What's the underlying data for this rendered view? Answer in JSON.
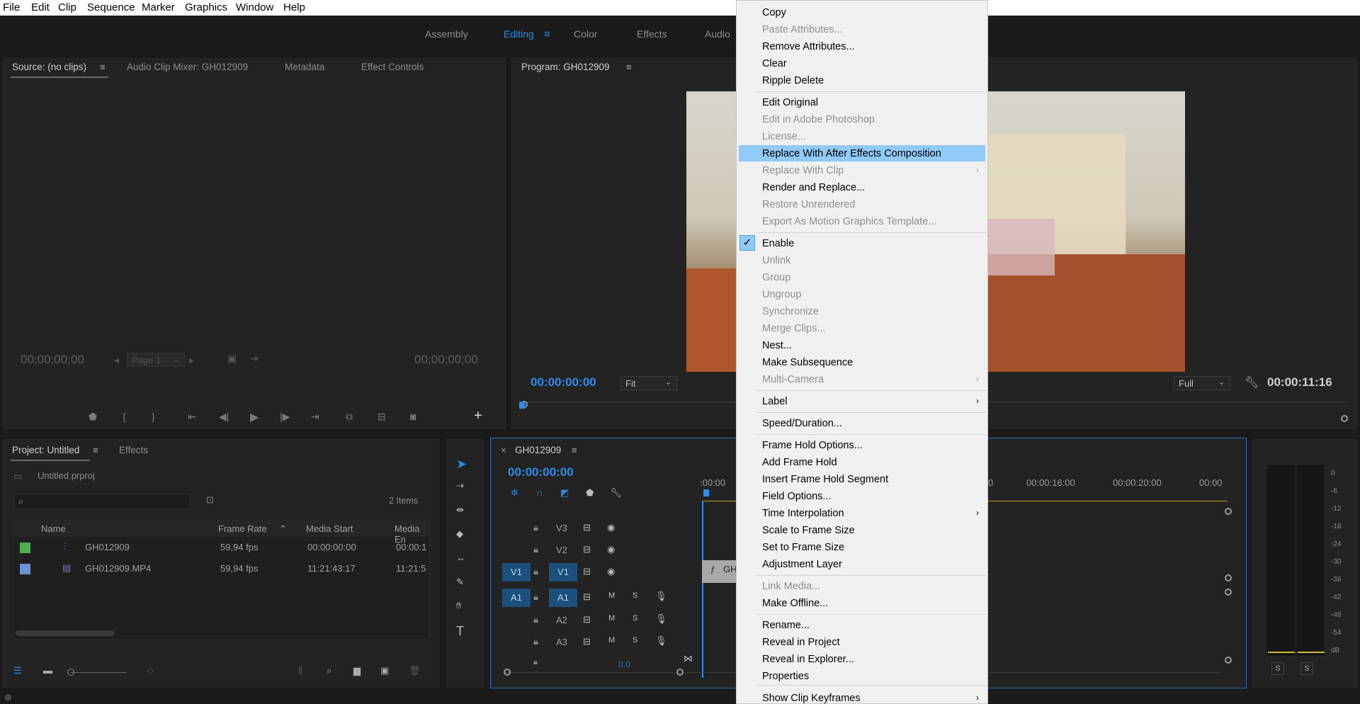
{
  "menubar": {
    "items": [
      "File",
      "Edit",
      "Clip",
      "Sequence",
      "Marker",
      "Graphics",
      "Window",
      "Help"
    ]
  },
  "workspaces": {
    "items": [
      "Assembly",
      "Editing",
      "Color",
      "Effects",
      "Audio"
    ],
    "active": "Editing"
  },
  "source_panel": {
    "tabs": [
      "Source: (no clips)",
      "Audio Clip Mixer: GH012909",
      "Metadata",
      "Effect Controls"
    ],
    "timecode_left": "00;00;00;00",
    "timecode_right": "00;00;00;00",
    "page_select": "Page 1"
  },
  "program_panel": {
    "title": "Program: GH012909",
    "timecode_current": "00:00:00:00",
    "fit_select": "Fit",
    "quality_select": "Full",
    "timecode_duration": "00:00:11:16"
  },
  "project_panel": {
    "tabs": [
      "Project: Untitled",
      "Effects"
    ],
    "file_name": "Untitled.prproj",
    "item_count": "2 Items",
    "columns": [
      "Name",
      "Frame Rate",
      "Media Start",
      "Media En"
    ],
    "rows": [
      {
        "color": "#4caf50",
        "name": "GH012909",
        "frame_rate": "59,94 fps",
        "media_start": "00:00:00:00",
        "media_end": "00:00:1"
      },
      {
        "color": "#6a93d4",
        "name": "GH012909.MP4",
        "frame_rate": "59,94 fps",
        "media_start": "11:21:43:17",
        "media_end": "11:21:5"
      }
    ]
  },
  "timeline": {
    "sequence_name": "GH012909",
    "timecode": "00:00:00:00",
    "ruler": [
      ":00:00",
      "0",
      "00:00:16:00",
      "00:00:20:00",
      "00:00"
    ],
    "video_tracks": [
      "V3",
      "V2",
      "V1"
    ],
    "audio_tracks": [
      "A1",
      "A2",
      "A3"
    ],
    "source_v": "V1",
    "source_a": "A1",
    "clip_label": "GH",
    "mute_label": "M",
    "solo_label": "S",
    "bottom_value": "0.0"
  },
  "meter": {
    "labels": [
      "0",
      "-6",
      "-12",
      "-18",
      "-24",
      "-30",
      "-36",
      "-42",
      "-48",
      "-54",
      "dB"
    ],
    "solo_buttons": [
      "S",
      "S"
    ]
  },
  "context_menu": {
    "items": [
      {
        "label": "Copy",
        "enabled": true
      },
      {
        "label": "Paste Attributes...",
        "enabled": false
      },
      {
        "label": "Remove Attributes...",
        "enabled": true
      },
      {
        "label": "Clear",
        "enabled": true
      },
      {
        "label": "Ripple Delete",
        "enabled": true
      },
      {
        "label": "Edit Original",
        "enabled": true
      },
      {
        "label": "Edit in Adobe Photoshop",
        "enabled": false
      },
      {
        "label": "License...",
        "enabled": false
      },
      {
        "label": "Replace With After Effects Composition",
        "enabled": true,
        "highlighted": true
      },
      {
        "label": "Replace With Clip",
        "enabled": false,
        "submenu": true
      },
      {
        "label": "Render and Replace...",
        "enabled": true
      },
      {
        "label": "Restore Unrendered",
        "enabled": false
      },
      {
        "label": "Export As Motion Graphics Template...",
        "enabled": false
      },
      {
        "label": "Enable",
        "enabled": true,
        "checked": true
      },
      {
        "label": "Unlink",
        "enabled": false
      },
      {
        "label": "Group",
        "enabled": false
      },
      {
        "label": "Ungroup",
        "enabled": false
      },
      {
        "label": "Synchronize",
        "enabled": false
      },
      {
        "label": "Merge Clips...",
        "enabled": false
      },
      {
        "label": "Nest...",
        "enabled": true
      },
      {
        "label": "Make Subsequence",
        "enabled": true
      },
      {
        "label": "Multi-Camera",
        "enabled": false,
        "submenu": true
      },
      {
        "label": "Label",
        "enabled": true,
        "submenu": true
      },
      {
        "label": "Speed/Duration...",
        "enabled": true
      },
      {
        "label": "Frame Hold Options...",
        "enabled": true
      },
      {
        "label": "Add Frame Hold",
        "enabled": true
      },
      {
        "label": "Insert Frame Hold Segment",
        "enabled": true
      },
      {
        "label": "Field Options...",
        "enabled": true
      },
      {
        "label": "Time Interpolation",
        "enabled": true,
        "submenu": true
      },
      {
        "label": "Scale to Frame Size",
        "enabled": true
      },
      {
        "label": "Set to Frame Size",
        "enabled": true
      },
      {
        "label": "Adjustment Layer",
        "enabled": true
      },
      {
        "label": "Link Media...",
        "enabled": false
      },
      {
        "label": "Make Offline...",
        "enabled": true
      },
      {
        "label": "Rename...",
        "enabled": true
      },
      {
        "label": "Reveal in Project",
        "enabled": true
      },
      {
        "label": "Reveal in Explorer...",
        "enabled": true
      },
      {
        "label": "Properties",
        "enabled": true
      },
      {
        "label": "Show Clip Keyframes",
        "enabled": true,
        "submenu": true
      }
    ]
  },
  "icons": {
    "hamburger": "menu-icon",
    "check": "check-icon",
    "submenu_arrow": "chevron-right-icon",
    "search": "search-icon"
  }
}
